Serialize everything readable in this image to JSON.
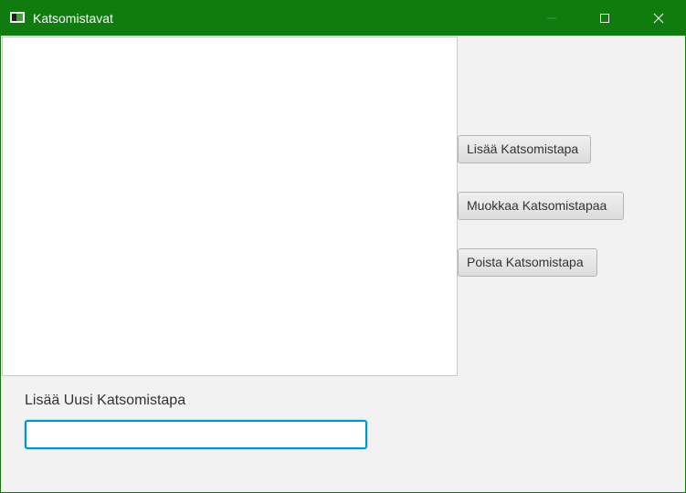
{
  "window": {
    "title": "Katsomistavat",
    "accent_color": "#107c10",
    "controls": {
      "minimize_icon": "minimize-icon",
      "maximize_icon": "maximize-icon",
      "close_icon": "close-icon"
    }
  },
  "list": {
    "items": []
  },
  "actions": {
    "add_label": "Lisää Katsomistapa",
    "edit_label": "Muokkaa Katsomistapaa",
    "delete_label": "Poista Katsomistapa"
  },
  "new_entry": {
    "label": "Lisää Uusi Katsomistapa",
    "value": "",
    "focus_color": "#0096c9"
  }
}
